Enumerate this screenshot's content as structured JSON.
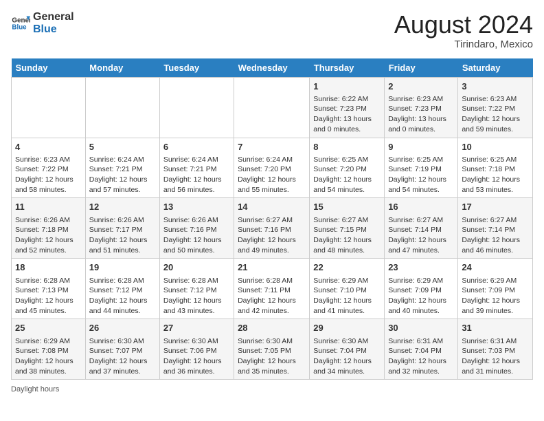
{
  "header": {
    "logo_line1": "General",
    "logo_line2": "Blue",
    "month_year": "August 2024",
    "location": "Tirindaro, Mexico"
  },
  "days_of_week": [
    "Sunday",
    "Monday",
    "Tuesday",
    "Wednesday",
    "Thursday",
    "Friday",
    "Saturday"
  ],
  "weeks": [
    [
      {
        "day": "",
        "info": ""
      },
      {
        "day": "",
        "info": ""
      },
      {
        "day": "",
        "info": ""
      },
      {
        "day": "",
        "info": ""
      },
      {
        "day": "1",
        "info": "Sunrise: 6:22 AM\nSunset: 7:23 PM\nDaylight: 13 hours and 0 minutes."
      },
      {
        "day": "2",
        "info": "Sunrise: 6:23 AM\nSunset: 7:23 PM\nDaylight: 13 hours and 0 minutes."
      },
      {
        "day": "3",
        "info": "Sunrise: 6:23 AM\nSunset: 7:22 PM\nDaylight: 12 hours and 59 minutes."
      }
    ],
    [
      {
        "day": "4",
        "info": "Sunrise: 6:23 AM\nSunset: 7:22 PM\nDaylight: 12 hours and 58 minutes."
      },
      {
        "day": "5",
        "info": "Sunrise: 6:24 AM\nSunset: 7:21 PM\nDaylight: 12 hours and 57 minutes."
      },
      {
        "day": "6",
        "info": "Sunrise: 6:24 AM\nSunset: 7:21 PM\nDaylight: 12 hours and 56 minutes."
      },
      {
        "day": "7",
        "info": "Sunrise: 6:24 AM\nSunset: 7:20 PM\nDaylight: 12 hours and 55 minutes."
      },
      {
        "day": "8",
        "info": "Sunrise: 6:25 AM\nSunset: 7:20 PM\nDaylight: 12 hours and 54 minutes."
      },
      {
        "day": "9",
        "info": "Sunrise: 6:25 AM\nSunset: 7:19 PM\nDaylight: 12 hours and 54 minutes."
      },
      {
        "day": "10",
        "info": "Sunrise: 6:25 AM\nSunset: 7:18 PM\nDaylight: 12 hours and 53 minutes."
      }
    ],
    [
      {
        "day": "11",
        "info": "Sunrise: 6:26 AM\nSunset: 7:18 PM\nDaylight: 12 hours and 52 minutes."
      },
      {
        "day": "12",
        "info": "Sunrise: 6:26 AM\nSunset: 7:17 PM\nDaylight: 12 hours and 51 minutes."
      },
      {
        "day": "13",
        "info": "Sunrise: 6:26 AM\nSunset: 7:16 PM\nDaylight: 12 hours and 50 minutes."
      },
      {
        "day": "14",
        "info": "Sunrise: 6:27 AM\nSunset: 7:16 PM\nDaylight: 12 hours and 49 minutes."
      },
      {
        "day": "15",
        "info": "Sunrise: 6:27 AM\nSunset: 7:15 PM\nDaylight: 12 hours and 48 minutes."
      },
      {
        "day": "16",
        "info": "Sunrise: 6:27 AM\nSunset: 7:14 PM\nDaylight: 12 hours and 47 minutes."
      },
      {
        "day": "17",
        "info": "Sunrise: 6:27 AM\nSunset: 7:14 PM\nDaylight: 12 hours and 46 minutes."
      }
    ],
    [
      {
        "day": "18",
        "info": "Sunrise: 6:28 AM\nSunset: 7:13 PM\nDaylight: 12 hours and 45 minutes."
      },
      {
        "day": "19",
        "info": "Sunrise: 6:28 AM\nSunset: 7:12 PM\nDaylight: 12 hours and 44 minutes."
      },
      {
        "day": "20",
        "info": "Sunrise: 6:28 AM\nSunset: 7:12 PM\nDaylight: 12 hours and 43 minutes."
      },
      {
        "day": "21",
        "info": "Sunrise: 6:28 AM\nSunset: 7:11 PM\nDaylight: 12 hours and 42 minutes."
      },
      {
        "day": "22",
        "info": "Sunrise: 6:29 AM\nSunset: 7:10 PM\nDaylight: 12 hours and 41 minutes."
      },
      {
        "day": "23",
        "info": "Sunrise: 6:29 AM\nSunset: 7:09 PM\nDaylight: 12 hours and 40 minutes."
      },
      {
        "day": "24",
        "info": "Sunrise: 6:29 AM\nSunset: 7:09 PM\nDaylight: 12 hours and 39 minutes."
      }
    ],
    [
      {
        "day": "25",
        "info": "Sunrise: 6:29 AM\nSunset: 7:08 PM\nDaylight: 12 hours and 38 minutes."
      },
      {
        "day": "26",
        "info": "Sunrise: 6:30 AM\nSunset: 7:07 PM\nDaylight: 12 hours and 37 minutes."
      },
      {
        "day": "27",
        "info": "Sunrise: 6:30 AM\nSunset: 7:06 PM\nDaylight: 12 hours and 36 minutes."
      },
      {
        "day": "28",
        "info": "Sunrise: 6:30 AM\nSunset: 7:05 PM\nDaylight: 12 hours and 35 minutes."
      },
      {
        "day": "29",
        "info": "Sunrise: 6:30 AM\nSunset: 7:04 PM\nDaylight: 12 hours and 34 minutes."
      },
      {
        "day": "30",
        "info": "Sunrise: 6:31 AM\nSunset: 7:04 PM\nDaylight: 12 hours and 32 minutes."
      },
      {
        "day": "31",
        "info": "Sunrise: 6:31 AM\nSunset: 7:03 PM\nDaylight: 12 hours and 31 minutes."
      }
    ]
  ],
  "footer": {
    "label": "Daylight hours"
  }
}
